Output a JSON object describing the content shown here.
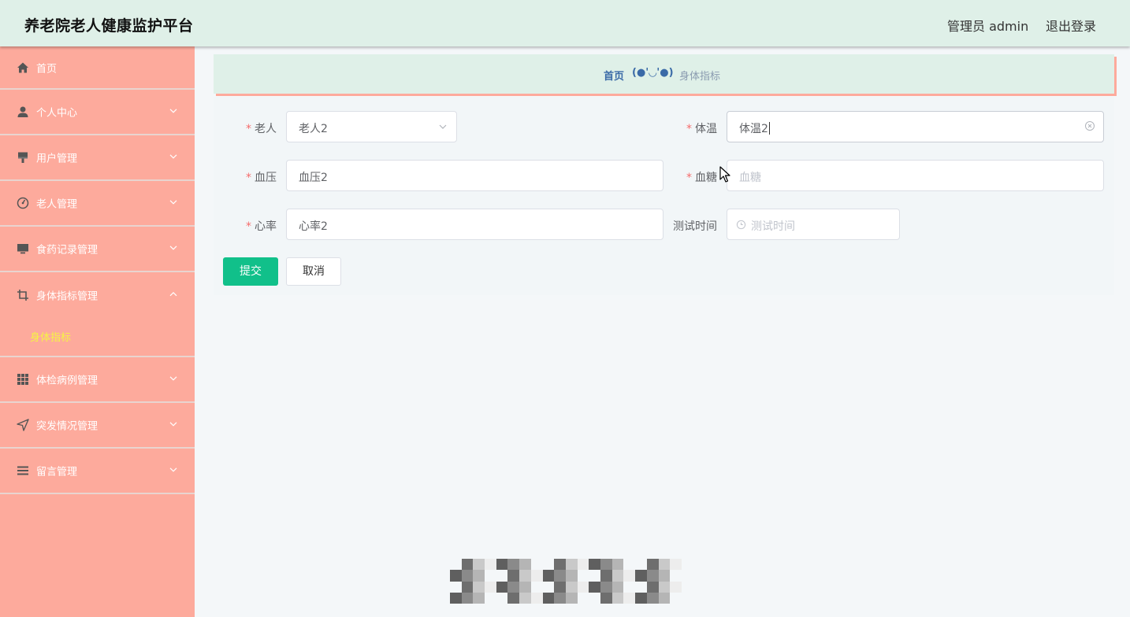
{
  "header": {
    "title": "养老院老人健康监护平台",
    "user": "管理员 admin",
    "logout": "退出登录"
  },
  "sidebar": {
    "items": [
      {
        "label": "首页",
        "icon": "home-icon"
      },
      {
        "label": "个人中心",
        "icon": "user-icon",
        "expanded": false
      },
      {
        "label": "用户管理",
        "icon": "brush-icon",
        "expanded": false
      },
      {
        "label": "老人管理",
        "icon": "gauge-icon",
        "expanded": false
      },
      {
        "label": "食药记录管理",
        "icon": "monitor-icon",
        "expanded": false
      },
      {
        "label": "身体指标管理",
        "icon": "crop-icon",
        "expanded": true,
        "children": [
          "身体指标"
        ]
      },
      {
        "label": "体检病例管理",
        "icon": "grid-icon",
        "expanded": false
      },
      {
        "label": "突发情况管理",
        "icon": "navigation-icon",
        "expanded": false
      },
      {
        "label": "留言管理",
        "icon": "list-icon",
        "expanded": false
      }
    ]
  },
  "breadcrumb": {
    "home": "首页",
    "separator": "(●'◡'●)",
    "current": "身体指标"
  },
  "form": {
    "elder": {
      "label": "老人",
      "value": "老人2",
      "required": true
    },
    "temperature": {
      "label": "体温",
      "value": "体温2",
      "required": true
    },
    "blood_pressure": {
      "label": "血压",
      "value": "血压2",
      "required": true
    },
    "blood_sugar": {
      "label": "血糖",
      "value": "",
      "placeholder": "血糖",
      "required": true
    },
    "heart_rate": {
      "label": "心率",
      "value": "心率2",
      "required": true
    },
    "test_time": {
      "label": "测试时间",
      "value": "",
      "placeholder": "测试时间",
      "required": false
    },
    "submit": "提交",
    "cancel": "取消"
  },
  "colors": {
    "header_bg": "#dff0e8",
    "sidebar_bg": "#fdaa9c",
    "active_submenu": "#f5f542",
    "primary_button": "#11c08a",
    "breadcrumb_text": "#3a6aa7",
    "required_star": "#f56c6c"
  }
}
